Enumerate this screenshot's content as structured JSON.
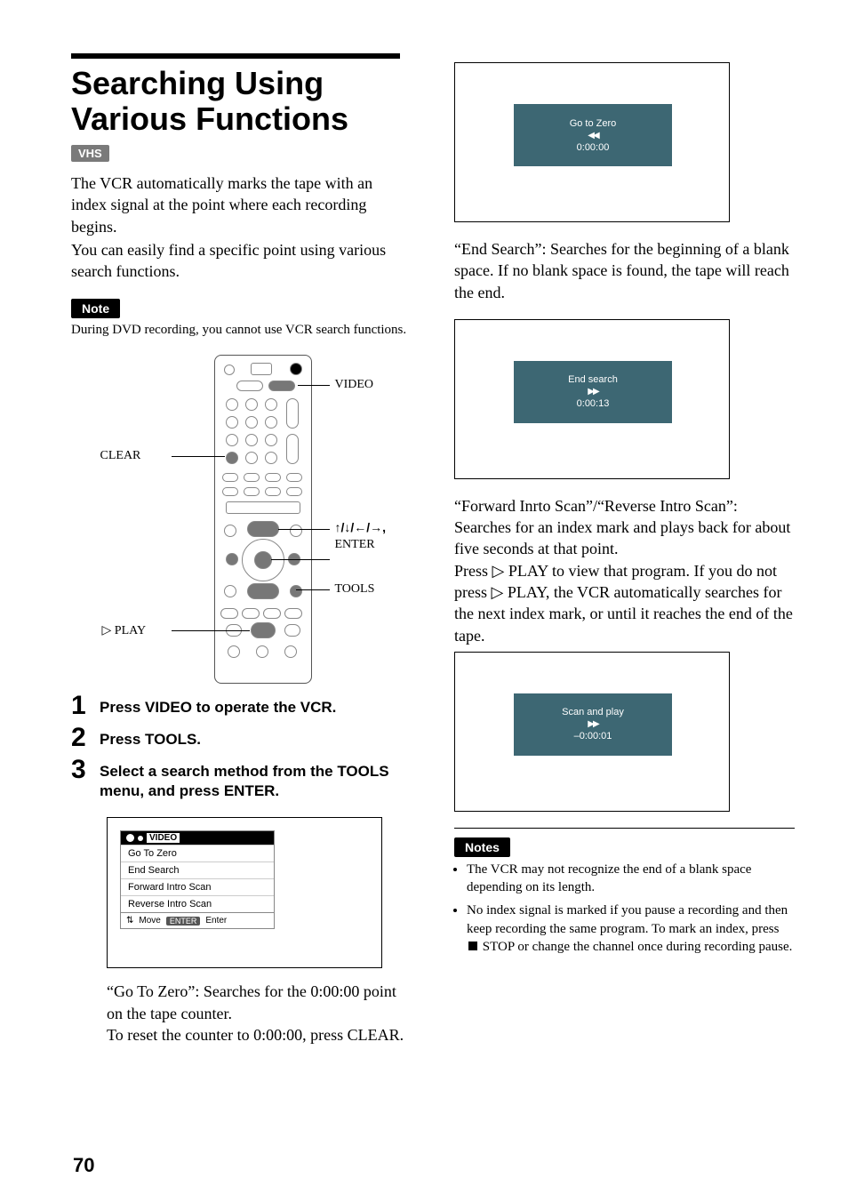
{
  "header": {
    "title": "Searching Using Various Functions",
    "vhs_tag": "VHS"
  },
  "intro": {
    "p1": "The VCR automatically marks the tape with an index signal at the point where each recording begins.",
    "p2": "You can easily find a specific point using various search functions."
  },
  "note_label": "Note",
  "note_text": "During DVD recording, you cannot use VCR search functions.",
  "remote_labels": {
    "video": "VIDEO",
    "clear": "CLEAR",
    "arrows": "↑/↓/←/→,",
    "enter": "ENTER",
    "tools": "TOOLS",
    "play_prefix": "▷",
    "play": "PLAY"
  },
  "steps": {
    "s1": "Press VIDEO to operate the VCR.",
    "s2": "Press TOOLS.",
    "s3": "Select a search method from the TOOLS menu, and press ENTER."
  },
  "tools_menu": {
    "header": "VIDEO",
    "items": [
      "Go To Zero",
      "End Search",
      "Forward Intro Scan",
      "Reverse Intro Scan"
    ],
    "footer_move": "Move",
    "footer_enter_btn": "ENTER",
    "footer_enter": "Enter"
  },
  "go_to_zero": {
    "desc": "“Go To Zero”: Searches for the 0:00:00 point on the tape counter.",
    "reset": "To reset the counter to 0:00:00, press CLEAR.",
    "panel_title": "Go to Zero",
    "panel_icon": "◀◀",
    "panel_time": "0:00:00"
  },
  "end_search": {
    "desc": "“End Search”: Searches for the beginning of a blank space. If no blank space is found, the tape will reach the end.",
    "panel_title": "End search",
    "panel_icon": "▶▶",
    "panel_time": "0:00:13"
  },
  "intro_scan": {
    "desc1": "“Forward Inrto Scan”/“Reverse Intro Scan”: Searches for an index mark and plays back for about five seconds at that point.",
    "desc2a": "Press ",
    "desc2_play": "▷",
    "desc2b": " PLAY to view that program. If you do not press ",
    "desc2c": " PLAY, the VCR automatically searches for the next index mark, or until it reaches the end of the tape.",
    "panel_title": "Scan and play",
    "panel_icon": "▶▶",
    "panel_time": "–0:00:01"
  },
  "notes_label": "Notes",
  "notes": {
    "n1": "The VCR may not recognize the end of a blank space depending on its length.",
    "n2a": "No index signal is marked if you pause a recording and then keep recording the same program. To mark an index, press ",
    "n2b": " STOP or change the channel once during recording pause."
  },
  "page_number": "70"
}
